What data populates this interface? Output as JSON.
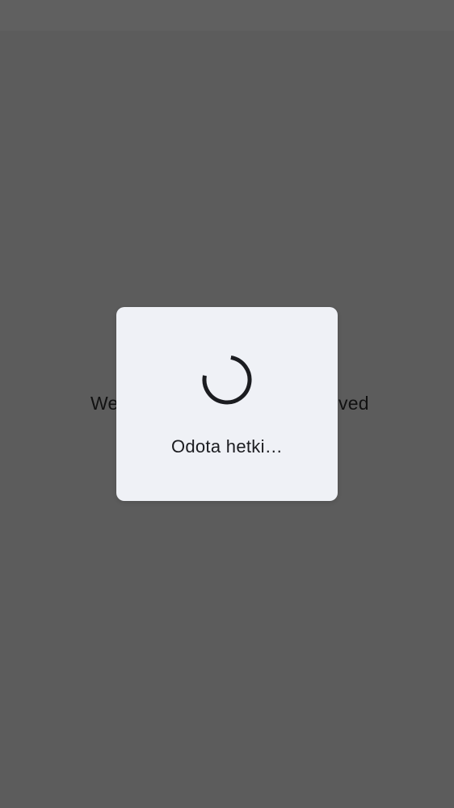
{
  "background": {
    "text_left": "We",
    "text_right": "ved"
  },
  "dialog": {
    "message": "Odota hetki…",
    "progress_icon": "circular-progress-spinner"
  },
  "colors": {
    "scrim": "#5c5c5c",
    "dialog_bg": "#eff1f6",
    "text": "#1b1c20",
    "spinner": "#1b1c20"
  }
}
